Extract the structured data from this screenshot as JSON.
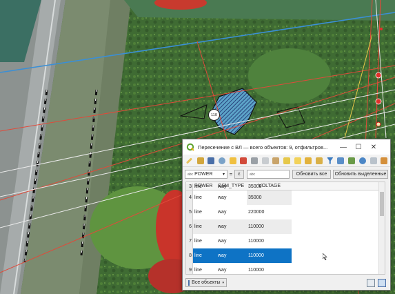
{
  "window": {
    "title": "Пересечение с ВЛ — всего объектов: 9, отфильтров...",
    "minimize": "—",
    "maximize": "☐",
    "close": "✕"
  },
  "filter": {
    "field": "POWER",
    "operator": "=",
    "expr_symbol": "ε",
    "value": "",
    "show_all": "Обновить все",
    "update_selected": "Обновить выделенные"
  },
  "table": {
    "columns": [
      "POWER",
      "OSM_TYPE",
      "VOLTAGE"
    ],
    "partial_top_row": {
      "num": "3",
      "power": "line",
      "osm_type": "way",
      "voltage": "35000"
    },
    "rows": [
      {
        "num": "4",
        "power": "line",
        "osm_type": "way",
        "voltage": "35000",
        "selected": false
      },
      {
        "num": "5",
        "power": "line",
        "osm_type": "way",
        "voltage": "220000",
        "selected": false
      },
      {
        "num": "6",
        "power": "line",
        "osm_type": "way",
        "voltage": "110000",
        "selected": false
      },
      {
        "num": "7",
        "power": "line",
        "osm_type": "way",
        "voltage": "110000",
        "selected": false
      },
      {
        "num": "8",
        "power": "line",
        "osm_type": "way",
        "voltage": "110000",
        "selected": true
      },
      {
        "num": "9",
        "power": "line",
        "osm_type": "way",
        "voltage": "110000",
        "selected": false
      }
    ]
  },
  "footer": {
    "show_features": "Все объекты"
  },
  "map": {
    "marker_label": "110"
  },
  "colors": {
    "selection": "#0e73c5",
    "power_line": "#e04a3a",
    "blue_line": "#3a8fd6",
    "hatch": "#1a2a7a"
  }
}
